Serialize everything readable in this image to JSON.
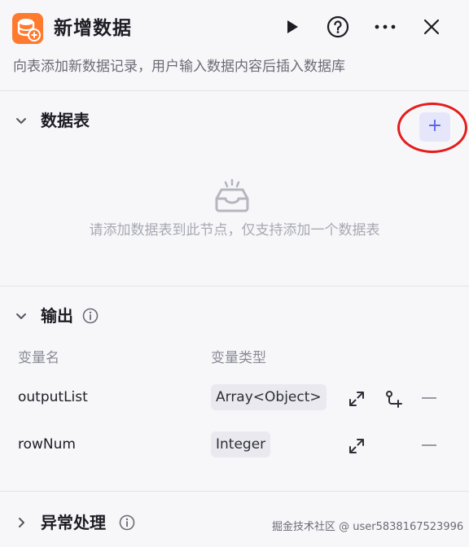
{
  "header": {
    "title": "新增数据",
    "description": "向表添加新数据记录，用户输入数据内容后插入数据库",
    "icons": [
      "database-add-icon",
      "play-icon",
      "help-icon",
      "more-icon",
      "close-icon"
    ]
  },
  "data_table": {
    "title": "数据表",
    "add_label": "+",
    "empty_text": "请添加数据表到此节点，仅支持添加一个数据表"
  },
  "output": {
    "title": "输出",
    "columns": {
      "name": "变量名",
      "type": "变量类型"
    },
    "rows": [
      {
        "name": "outputList",
        "type": "Array<Object>"
      },
      {
        "name": "rowNum",
        "type": "Integer"
      }
    ]
  },
  "error_handling": {
    "title": "异常处理"
  },
  "watermark": "掘金技术社区 @ user5838167523996",
  "colors": {
    "accent": "#5a5ee6",
    "app_icon": "#ff7a2e",
    "highlight": "#e51c1c"
  }
}
